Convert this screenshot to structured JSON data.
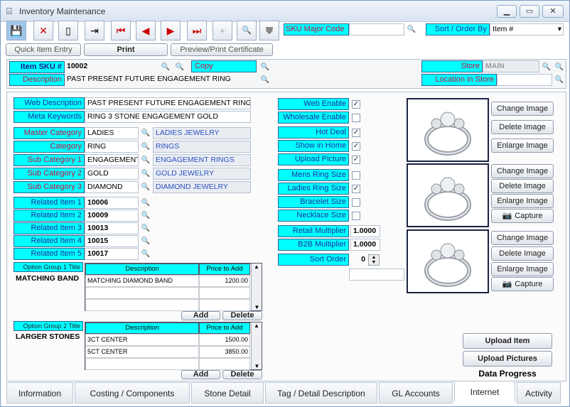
{
  "window": {
    "title": "Inventory Maintenance"
  },
  "toolbar": {
    "sku_major_code_label": "SKU Major Code",
    "sort_order_label": "Sort / Order By",
    "sort_order_value": "Item #"
  },
  "subbar": {
    "quick_item_entry": "Quick Item Entry",
    "print": "Print",
    "preview_print": "Preview/Print Certificate"
  },
  "header": {
    "item_sku_label": "Item SKU #",
    "item_sku_value": "10002",
    "copy_label": "Copy",
    "description_label": "Description",
    "description_value": "PAST PRESENT FUTURE ENGAGEMENT RING",
    "store_label": "Store",
    "store_value": "MAIN",
    "location_label": "Location in Store"
  },
  "left": {
    "web_description_label": "Web Description",
    "web_description_value": "PAST PRESENT FUTURE ENGAGEMENT RING",
    "meta_keywords_label": "Meta Keywords",
    "meta_keywords_value": "RING 3 STONE ENGAGEMENT GOLD",
    "categories": [
      {
        "label": "Master Category",
        "code": "LADIES",
        "name": "LADIES JEWELRY"
      },
      {
        "label": "Category",
        "code": "RING",
        "name": "RINGS"
      },
      {
        "label": "Sub Category 1",
        "code": "ENGAGEMENT",
        "name": "ENGAGEMENT RINGS"
      },
      {
        "label": "Sub Category 2",
        "code": "GOLD",
        "name": "GOLD JEWELRY"
      },
      {
        "label": "Sub Category 3",
        "code": "DIAMOND",
        "name": "DIAMOND JEWELRY"
      }
    ],
    "related": [
      {
        "label": "Related Item 1",
        "value": "10006"
      },
      {
        "label": "Related Item 2",
        "value": "10009"
      },
      {
        "label": "Related Item 3",
        "value": "10013"
      },
      {
        "label": "Related Item 4",
        "value": "10015"
      },
      {
        "label": "Related Item 5",
        "value": "10017"
      }
    ],
    "option_group1": {
      "title_label": "Option Group 1 Title",
      "title_value": "MATCHING BAND",
      "col_desc": "Description",
      "col_price": "Price to Add",
      "rows": [
        {
          "desc": "MATCHING DIAMOND BAND",
          "price": "1200.00"
        }
      ],
      "add": "Add",
      "delete": "Delete"
    },
    "option_group2": {
      "title_label": "Option Group 2 Title",
      "title_value": "LARGER STONES",
      "col_desc": "Description",
      "col_price": "Price to Add",
      "rows": [
        {
          "desc": "3CT CENTER",
          "price": "1500.00"
        },
        {
          "desc": "5CT CENTER",
          "price": "3850.00"
        }
      ],
      "add": "Add",
      "delete": "Delete"
    }
  },
  "middle": {
    "flags": [
      {
        "label": "Web Enable",
        "checked": true
      },
      {
        "label": "Wholesale Enable",
        "checked": false
      },
      {
        "label": "Hot Deal",
        "checked": true
      },
      {
        "label": "Show in Home",
        "checked": true
      },
      {
        "label": "Upload Picture",
        "checked": true
      },
      {
        "label": "Mens Ring Size",
        "checked": false
      },
      {
        "label": "Ladies Ring Size",
        "checked": true
      },
      {
        "label": "Bracelet Size",
        "checked": false
      },
      {
        "label": "Necklace Size",
        "checked": false
      }
    ],
    "retail_multiplier_label": "Retail Multiplier",
    "retail_multiplier_value": "1.0000",
    "b2b_multiplier_label": "B2B Multiplier",
    "b2b_multiplier_value": "1.0000",
    "sort_order_label": "Sort Order",
    "sort_order_value": "0"
  },
  "images": {
    "change": "Change Image",
    "delete": "Delete Image",
    "enlarge": "Enlarge Image",
    "capture": "Capture"
  },
  "actions": {
    "upload_item": "Upload Item",
    "upload_pictures": "Upload Pictures",
    "data_progress": "Data Progress"
  },
  "tabs": [
    "Information",
    "Costing / Components",
    "Stone Detail",
    "Tag / Detail Description",
    "GL Accounts",
    "Internet",
    "Activity"
  ],
  "active_tab": "Internet"
}
